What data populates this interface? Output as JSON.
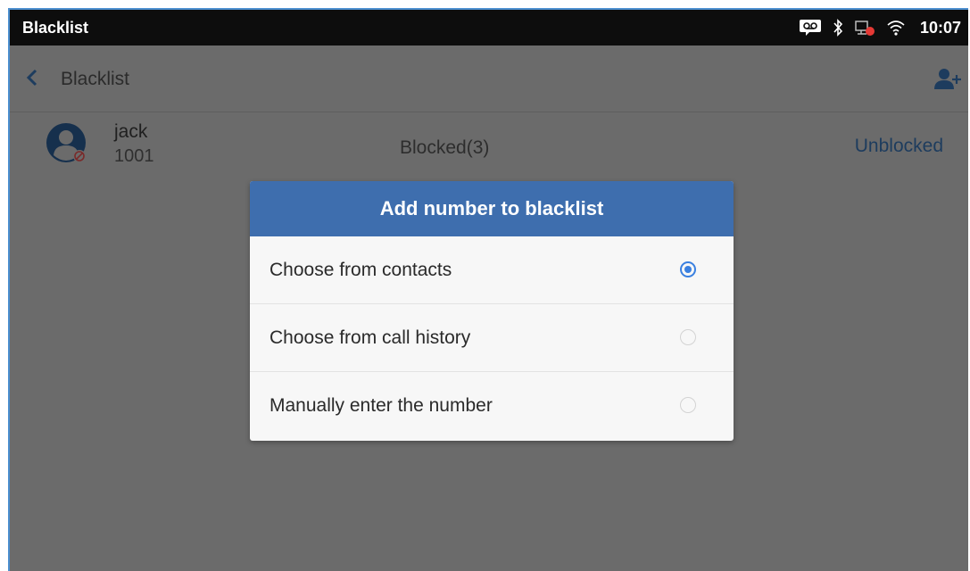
{
  "status_bar": {
    "title": "Blacklist",
    "time": "10:07",
    "icons": [
      "voicemail-icon",
      "bluetooth-icon",
      "network-error-icon",
      "wifi-icon"
    ]
  },
  "topbar": {
    "title": "Blacklist",
    "back_icon": "chevron-left-icon",
    "add_icon": "add-contact-icon"
  },
  "contact": {
    "name": "jack",
    "number": "1001",
    "blocked": "Blocked(3)",
    "action": "Unblocked"
  },
  "dialog": {
    "title": "Add number to blacklist",
    "options": [
      {
        "label": "Choose from contacts",
        "selected": true
      },
      {
        "label": "Choose from call history",
        "selected": false
      },
      {
        "label": "Manually enter the number",
        "selected": false
      }
    ]
  },
  "colors": {
    "dialog_header": "#3e6eae",
    "radio_selected": "#3a80e0",
    "overlay": "#6b6b6b",
    "status_bar": "#0d0d0d"
  }
}
